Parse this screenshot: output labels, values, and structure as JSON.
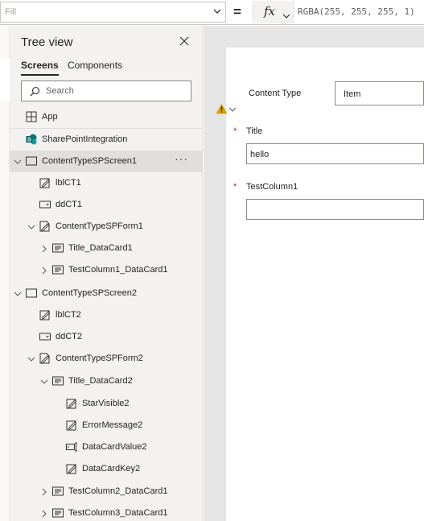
{
  "formula_bar": {
    "property": "Fill",
    "equals": "=",
    "fx_label": "fx",
    "formula": "RGBA(255, 255, 255, 1)"
  },
  "tree_view": {
    "title": "Tree view",
    "tabs": [
      {
        "label": "Screens",
        "active": true
      },
      {
        "label": "Components",
        "active": false
      }
    ],
    "search_placeholder": "Search",
    "items": [
      {
        "label": "App",
        "icon": "app-icon"
      },
      {
        "label": "SharePointIntegration",
        "icon": "sharepoint-icon"
      },
      {
        "label": "ContentTypeSPScreen1",
        "icon": "screen-icon",
        "expanded": true,
        "selected": true
      },
      {
        "label": "lblCT1",
        "icon": "label-icon"
      },
      {
        "label": "ddCT1",
        "icon": "dropdown-icon"
      },
      {
        "label": "ContentTypeSPForm1",
        "icon": "form-icon",
        "expanded": true
      },
      {
        "label": "Title_DataCard1",
        "icon": "card-icon",
        "expanded": false
      },
      {
        "label": "TestColumn1_DataCard1",
        "icon": "card-icon",
        "expanded": false
      },
      {
        "label": "ContentTypeSPScreen2",
        "icon": "screen-icon",
        "expanded": true
      },
      {
        "label": "lblCT2",
        "icon": "label-icon"
      },
      {
        "label": "ddCT2",
        "icon": "dropdown-icon"
      },
      {
        "label": "ContentTypeSPForm2",
        "icon": "form-icon",
        "expanded": true
      },
      {
        "label": "Title_DataCard2",
        "icon": "card-icon",
        "expanded": true
      },
      {
        "label": "StarVisible2",
        "icon": "label-icon"
      },
      {
        "label": "ErrorMessage2",
        "icon": "label-icon"
      },
      {
        "label": "DataCardValue2",
        "icon": "textinput-icon"
      },
      {
        "label": "DataCardKey2",
        "icon": "label-icon"
      },
      {
        "label": "TestColumn2_DataCard1",
        "icon": "card-icon",
        "expanded": false
      },
      {
        "label": "TestColumn3_DataCard1",
        "icon": "card-icon",
        "expanded": false
      }
    ],
    "more_label": "···"
  },
  "form": {
    "content_type_label": "Content Type",
    "content_type_value": "Item",
    "title_label": "Title",
    "title_value": "hello",
    "testcolumn_label": "TestColumn1",
    "testcolumn_value": "",
    "required_marker": "*",
    "warning_icon": "warning-icon",
    "warning_color": "#d9a300"
  },
  "colors": {
    "accent": "#0078d4",
    "selected_row": "#e1dfdd",
    "pane_bg": "#f3f2f1",
    "canvas_bg": "#e5e5e5"
  }
}
